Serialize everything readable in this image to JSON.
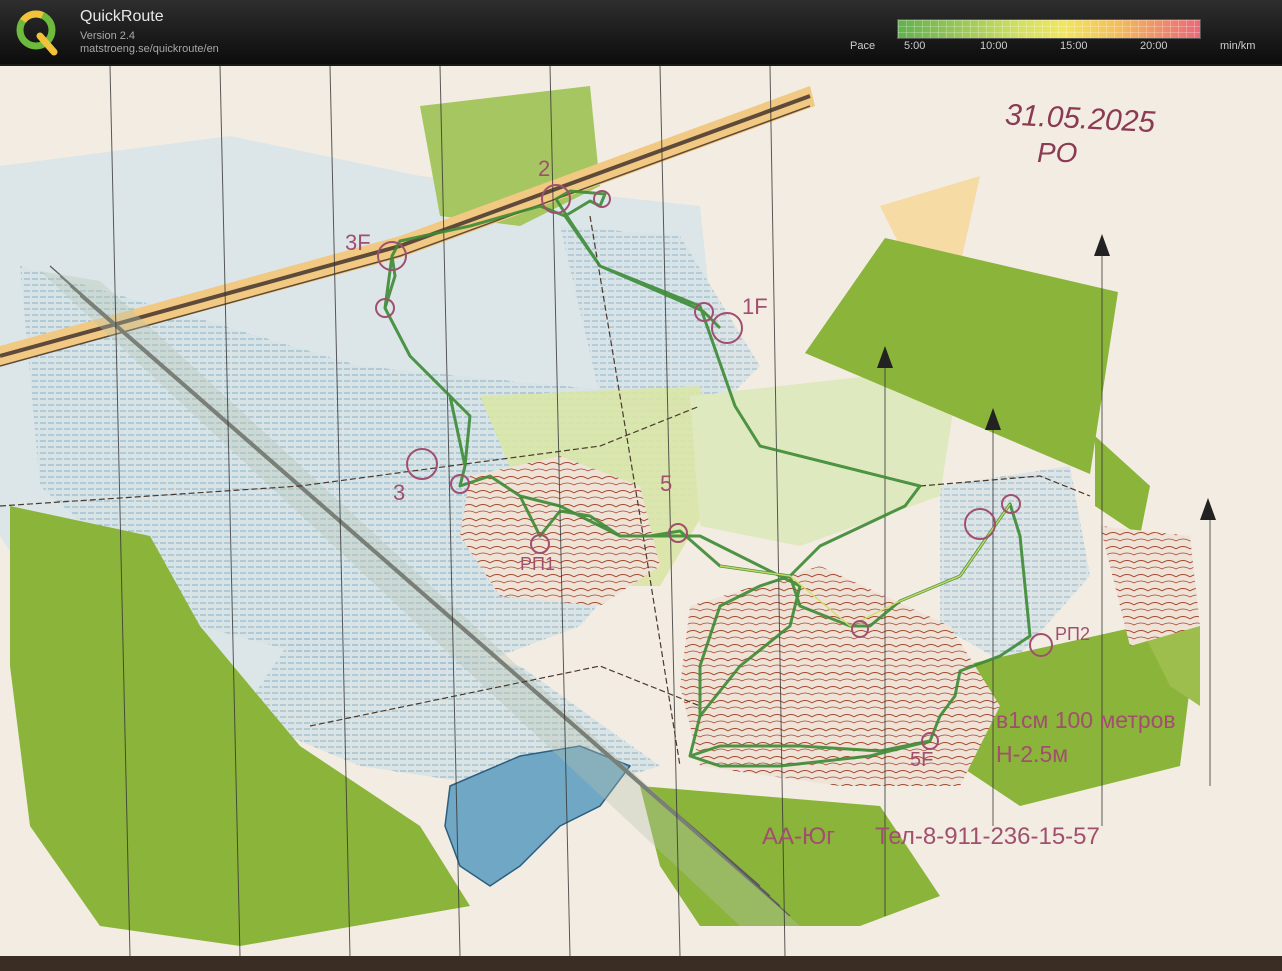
{
  "app": {
    "title": "QuickRoute",
    "version": "Version 2.4",
    "url": "matstroeng.se/quickroute/en"
  },
  "pace_scale": {
    "label": "Pace",
    "ticks": [
      "5:00",
      "10:00",
      "15:00",
      "20:00"
    ],
    "unit": "min/km",
    "colors": [
      "#62b04d",
      "#d2df63",
      "#f1e65f",
      "#f4bf5c",
      "#e96a79"
    ]
  },
  "map": {
    "date": "31.05.2025",
    "class_code": "РО",
    "controls": {
      "c2": "2",
      "c3f": "3F",
      "c1f": "1F",
      "c3": "3",
      "c5": "5",
      "rp1": "РП1",
      "rp2": "РП2",
      "c5f": "5F"
    },
    "scale_line1": "в1см 100 метров",
    "scale_line2": "H-2.5м",
    "organizer": "АА-Юг",
    "phone": "Тел-8-911-236-15-57",
    "colors": {
      "paper": "#f3ece2",
      "open_land": "#dde7ea",
      "green_dark": "#8bb43a",
      "green_light": "#d9e6a6",
      "contour": "#a4492e",
      "overprint": "#a0506e",
      "water": "#6fa7c4",
      "route": "#4a9a3e"
    }
  }
}
